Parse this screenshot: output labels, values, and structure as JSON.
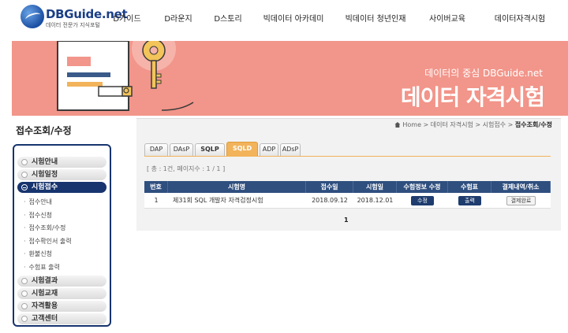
{
  "header": {
    "logo_name": "DBGuide.net",
    "logo_sub": "데이터 전문가 지식포털",
    "nav": [
      "D가이드",
      "D라운지",
      "D스토리",
      "빅데이터 아카데미",
      "빅데이터 청년인재",
      "사이버교육",
      "데이터자격시험"
    ]
  },
  "banner": {
    "subtitle": "데이터의 중심 DBGuide.net",
    "title": "데이터 자격시험",
    "color": "#f2958a"
  },
  "sidebar": {
    "title": "접수조회/수정",
    "items": [
      {
        "label": "시험안내"
      },
      {
        "label": "시험일정"
      },
      {
        "label": "시험접수"
      },
      {
        "label": "시험결과"
      },
      {
        "label": "시험교재"
      },
      {
        "label": "자격활용"
      },
      {
        "label": "고객센터"
      }
    ],
    "sub_items": [
      "접수안내",
      "접수신청",
      "접수조회/수정",
      "접수확인서 출력",
      "환불신청",
      "수험표 출력"
    ]
  },
  "breadcrumb": {
    "home": "Home",
    "path1": "데이터 자격시험",
    "path2": "시험접수",
    "current": "접수조회/수정"
  },
  "tabs": [
    "DAP",
    "DAsP",
    "SQLP",
    "SQLD",
    "ADP",
    "ADsP"
  ],
  "active_tab": "SQLD",
  "count_text": "[ 총 : 1건, 페이지수 : 1 / 1 ]",
  "table": {
    "headers": [
      "번호",
      "시험명",
      "접수일",
      "시험일",
      "수험정보 수정",
      "수험표",
      "결제내역/취소"
    ],
    "rows": [
      {
        "no": "1",
        "name": "제31회 SQL 개발자 자격검정시험",
        "reg_date": "2018.09.12",
        "exam_date": "2018.12.01",
        "edit_btn": "수정",
        "print_btn": "출력",
        "payment_btn": "결제완료"
      }
    ]
  },
  "pager": {
    "current": "1"
  }
}
